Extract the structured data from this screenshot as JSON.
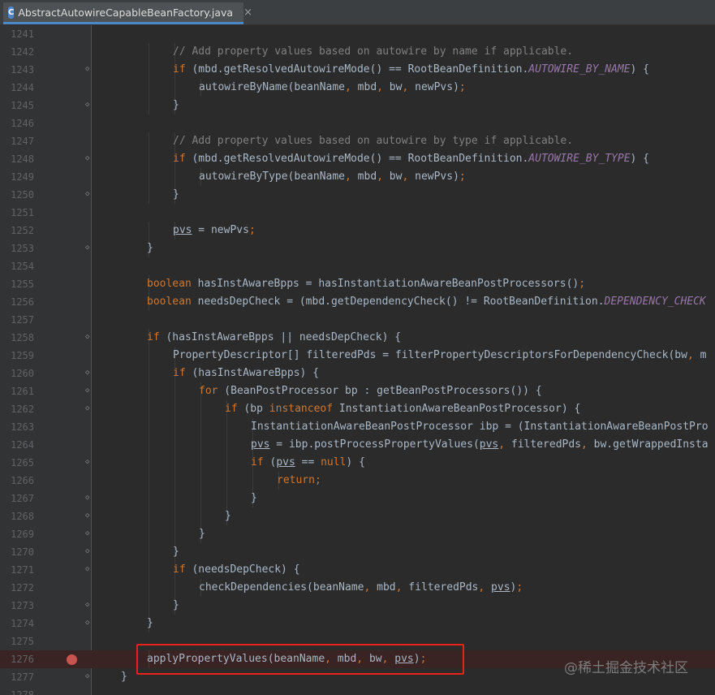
{
  "tab": {
    "icon": "java-class-icon",
    "label": "AbstractAutowireCapableBeanFactory.java",
    "close": "×"
  },
  "editor": {
    "lines": [
      {
        "n": "1241",
        "indent": 0,
        "tokens": []
      },
      {
        "n": "1242",
        "indent": 3,
        "tokens": [
          {
            "t": "// Add property values based on autowire by name if applicable.",
            "c": "cm"
          }
        ]
      },
      {
        "n": "1243",
        "indent": 3,
        "fold": true,
        "tokens": [
          {
            "t": "if",
            "c": "kw"
          },
          {
            "t": " (mbd.getResolvedAutowireMode() == RootBeanDefinition."
          },
          {
            "t": "AUTOWIRE_BY_NAME",
            "c": "cn"
          },
          {
            "t": ") {"
          }
        ]
      },
      {
        "n": "1244",
        "indent": 4,
        "tokens": [
          {
            "t": "autowireByName(beanName"
          },
          {
            "t": ",",
            "c": "dl"
          },
          {
            "t": " mbd"
          },
          {
            "t": ",",
            "c": "dl"
          },
          {
            "t": " bw"
          },
          {
            "t": ",",
            "c": "dl"
          },
          {
            "t": " newPvs)"
          },
          {
            "t": ";",
            "c": "dl"
          }
        ]
      },
      {
        "n": "1245",
        "indent": 3,
        "fold": true,
        "tokens": [
          {
            "t": "}"
          }
        ]
      },
      {
        "n": "1246",
        "indent": 0,
        "tokens": []
      },
      {
        "n": "1247",
        "indent": 3,
        "tokens": [
          {
            "t": "// Add property values based on autowire by type if applicable.",
            "c": "cm"
          }
        ]
      },
      {
        "n": "1248",
        "indent": 3,
        "fold": true,
        "tokens": [
          {
            "t": "if",
            "c": "kw"
          },
          {
            "t": " (mbd.getResolvedAutowireMode() == RootBeanDefinition."
          },
          {
            "t": "AUTOWIRE_BY_TYPE",
            "c": "cn"
          },
          {
            "t": ") {"
          }
        ]
      },
      {
        "n": "1249",
        "indent": 4,
        "tokens": [
          {
            "t": "autowireByType(beanName"
          },
          {
            "t": ",",
            "c": "dl"
          },
          {
            "t": " mbd"
          },
          {
            "t": ",",
            "c": "dl"
          },
          {
            "t": " bw"
          },
          {
            "t": ",",
            "c": "dl"
          },
          {
            "t": " newPvs)"
          },
          {
            "t": ";",
            "c": "dl"
          }
        ]
      },
      {
        "n": "1250",
        "indent": 3,
        "fold": true,
        "tokens": [
          {
            "t": "}"
          }
        ]
      },
      {
        "n": "1251",
        "indent": 0,
        "tokens": []
      },
      {
        "n": "1252",
        "indent": 3,
        "tokens": [
          {
            "t": "pvs",
            "c": "ul"
          },
          {
            "t": " = newPvs"
          },
          {
            "t": ";",
            "c": "dl"
          }
        ]
      },
      {
        "n": "1253",
        "indent": 2,
        "fold": true,
        "tokens": [
          {
            "t": "}"
          }
        ]
      },
      {
        "n": "1254",
        "indent": 0,
        "tokens": []
      },
      {
        "n": "1255",
        "indent": 2,
        "tokens": [
          {
            "t": "boolean",
            "c": "kw"
          },
          {
            "t": " hasInstAwareBpps = hasInstantiationAwareBeanPostProcessors()"
          },
          {
            "t": ";",
            "c": "dl"
          }
        ]
      },
      {
        "n": "1256",
        "indent": 2,
        "tokens": [
          {
            "t": "boolean",
            "c": "kw"
          },
          {
            "t": " needsDepCheck = (mbd.getDependencyCheck() != RootBeanDefinition."
          },
          {
            "t": "DEPENDENCY_CHECK",
            "c": "cn"
          }
        ]
      },
      {
        "n": "1257",
        "indent": 0,
        "tokens": []
      },
      {
        "n": "1258",
        "indent": 2,
        "fold": true,
        "tokens": [
          {
            "t": "if",
            "c": "kw"
          },
          {
            "t": " (hasInstAwareBpps || needsDepCheck) {"
          }
        ]
      },
      {
        "n": "1259",
        "indent": 3,
        "tokens": [
          {
            "t": "PropertyDescriptor[] filteredPds = filterPropertyDescriptorsForDependencyCheck(bw"
          },
          {
            "t": ",",
            "c": "dl"
          },
          {
            "t": " m"
          }
        ]
      },
      {
        "n": "1260",
        "indent": 3,
        "fold": true,
        "tokens": [
          {
            "t": "if",
            "c": "kw"
          },
          {
            "t": " (hasInstAwareBpps) {"
          }
        ]
      },
      {
        "n": "1261",
        "indent": 4,
        "fold": true,
        "tokens": [
          {
            "t": "for",
            "c": "kw"
          },
          {
            "t": " (BeanPostProcessor bp : getBeanPostProcessors()) {"
          }
        ]
      },
      {
        "n": "1262",
        "indent": 5,
        "fold": true,
        "tokens": [
          {
            "t": "if",
            "c": "kw"
          },
          {
            "t": " (bp "
          },
          {
            "t": "instanceof",
            "c": "kw"
          },
          {
            "t": " InstantiationAwareBeanPostProcessor) {"
          }
        ]
      },
      {
        "n": "1263",
        "indent": 6,
        "tokens": [
          {
            "t": "InstantiationAwareBeanPostProcessor ibp = (InstantiationAwareBeanPostPro"
          }
        ]
      },
      {
        "n": "1264",
        "indent": 6,
        "tokens": [
          {
            "t": "pvs",
            "c": "ul"
          },
          {
            "t": " = ibp.postProcessPropertyValues("
          },
          {
            "t": "pvs",
            "c": "ul"
          },
          {
            "t": ",",
            "c": "dl"
          },
          {
            "t": " filteredPds"
          },
          {
            "t": ",",
            "c": "dl"
          },
          {
            "t": " bw.getWrappedInsta"
          }
        ]
      },
      {
        "n": "1265",
        "indent": 6,
        "fold": true,
        "tokens": [
          {
            "t": "if",
            "c": "kw"
          },
          {
            "t": " ("
          },
          {
            "t": "pvs",
            "c": "ul"
          },
          {
            "t": " == "
          },
          {
            "t": "null",
            "c": "kw"
          },
          {
            "t": ") {"
          }
        ]
      },
      {
        "n": "1266",
        "indent": 7,
        "tokens": [
          {
            "t": "return;",
            "c": "kw"
          }
        ]
      },
      {
        "n": "1267",
        "indent": 6,
        "fold": true,
        "tokens": [
          {
            "t": "}"
          }
        ]
      },
      {
        "n": "1268",
        "indent": 5,
        "fold": true,
        "tokens": [
          {
            "t": "}"
          }
        ]
      },
      {
        "n": "1269",
        "indent": 4,
        "fold": true,
        "tokens": [
          {
            "t": "}"
          }
        ]
      },
      {
        "n": "1270",
        "indent": 3,
        "fold": true,
        "tokens": [
          {
            "t": "}"
          }
        ]
      },
      {
        "n": "1271",
        "indent": 3,
        "fold": true,
        "tokens": [
          {
            "t": "if",
            "c": "kw"
          },
          {
            "t": " (needsDepCheck) {"
          }
        ]
      },
      {
        "n": "1272",
        "indent": 4,
        "tokens": [
          {
            "t": "checkDependencies(beanName"
          },
          {
            "t": ",",
            "c": "dl"
          },
          {
            "t": " mbd"
          },
          {
            "t": ",",
            "c": "dl"
          },
          {
            "t": " filteredPds"
          },
          {
            "t": ",",
            "c": "dl"
          },
          {
            "t": " "
          },
          {
            "t": "pvs",
            "c": "ul"
          },
          {
            "t": ")"
          },
          {
            "t": ";",
            "c": "dl"
          }
        ]
      },
      {
        "n": "1273",
        "indent": 3,
        "fold": true,
        "tokens": [
          {
            "t": "}"
          }
        ]
      },
      {
        "n": "1274",
        "indent": 2,
        "fold": true,
        "tokens": [
          {
            "t": "}"
          }
        ]
      },
      {
        "n": "1275",
        "indent": 0,
        "tokens": []
      },
      {
        "n": "1276",
        "indent": 2,
        "breakpoint": true,
        "tokens": [
          {
            "t": "applyPropertyValues(beanName"
          },
          {
            "t": ",",
            "c": "dl"
          },
          {
            "t": " mbd"
          },
          {
            "t": ",",
            "c": "dl"
          },
          {
            "t": " bw"
          },
          {
            "t": ",",
            "c": "dl"
          },
          {
            "t": " "
          },
          {
            "t": "pvs",
            "c": "ul"
          },
          {
            "t": ")"
          },
          {
            "t": ";",
            "c": "dl"
          }
        ]
      },
      {
        "n": "1277",
        "indent": 1,
        "fold": true,
        "tokens": [
          {
            "t": "}"
          }
        ]
      },
      {
        "n": "1278",
        "indent": 0,
        "tokens": []
      }
    ]
  },
  "colors": {
    "background": "#2b2b2b",
    "gutter": "#313335",
    "keyword": "#cc7832",
    "comment": "#808080",
    "constant": "#9876aa",
    "text": "#a9b7c6",
    "breakpoint": "#c75450",
    "highlight_box": "#e8211b"
  },
  "watermark": "@稀土掘金技术社区"
}
